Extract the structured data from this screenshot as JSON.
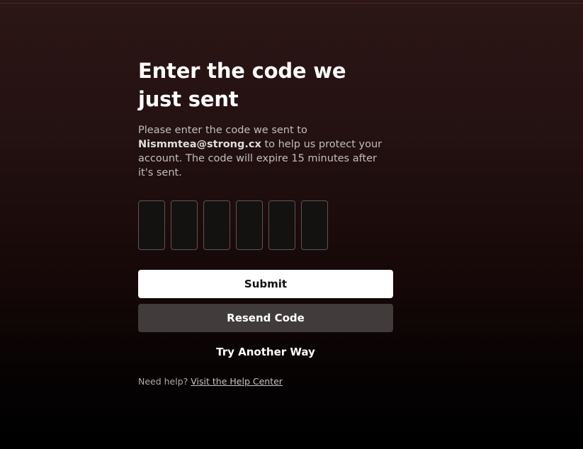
{
  "heading": "Enter the code we just sent",
  "description": {
    "before": "Please enter the code we sent to ",
    "email": "Nismmtea@strong.cx",
    "after": " to help us protect your account. The code will expire 15 minutes after it's sent."
  },
  "code_inputs": [
    "",
    "",
    "",
    "",
    "",
    ""
  ],
  "buttons": {
    "submit_label": "Submit",
    "resend_label": "Resend Code",
    "try_another_label": "Try Another Way"
  },
  "help": {
    "prefix": "Need help? ",
    "link_label": "Visit the Help Center"
  }
}
